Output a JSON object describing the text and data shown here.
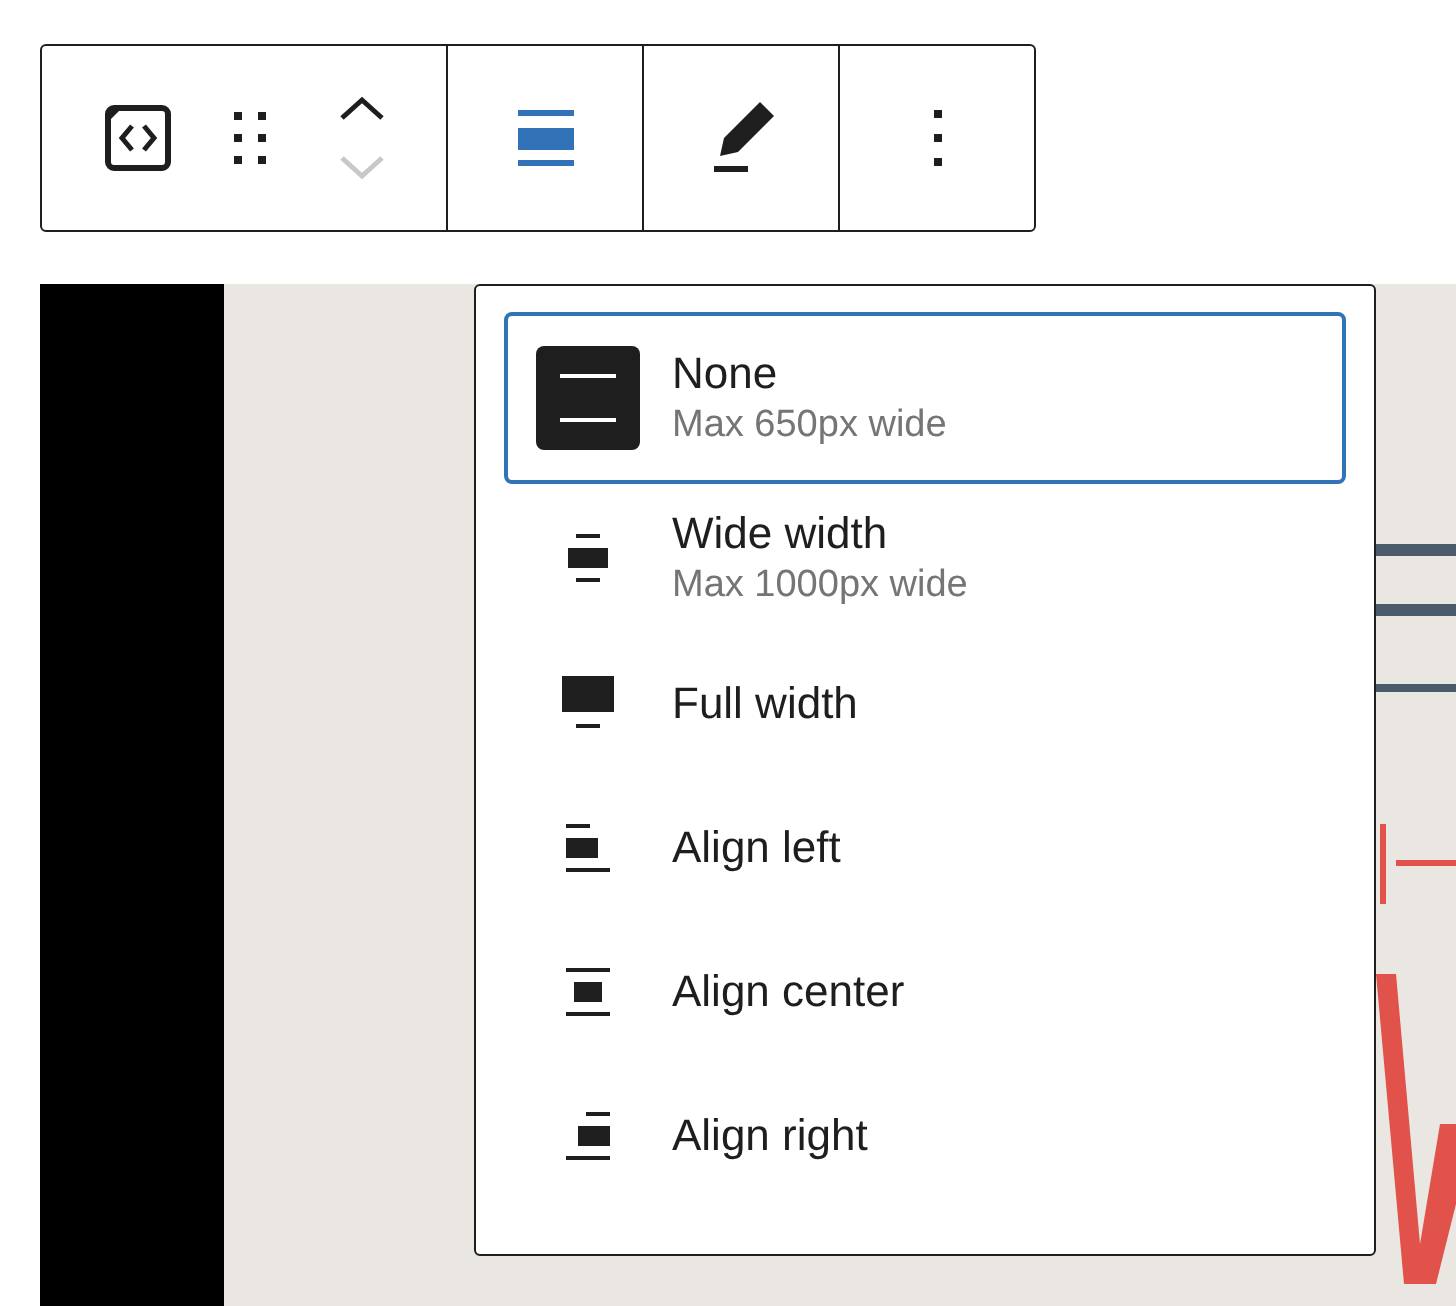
{
  "toolbar": {
    "groups": [
      {
        "buttons": [
          {
            "kind": "block_type",
            "disabled": false
          },
          {
            "kind": "drag",
            "disabled": false
          },
          {
            "kind": "mover",
            "up_disabled": false,
            "down_disabled": true
          }
        ]
      },
      {
        "buttons": [
          {
            "kind": "align",
            "expanded": true
          }
        ]
      },
      {
        "buttons": [
          {
            "kind": "edit",
            "disabled": false
          }
        ]
      },
      {
        "buttons": [
          {
            "kind": "more",
            "disabled": false
          }
        ]
      }
    ]
  },
  "align_menu": {
    "items": [
      {
        "kind": "none",
        "label": "None",
        "description": "Max 650px wide",
        "selected": true
      },
      {
        "kind": "wide",
        "label": "Wide width",
        "description": "Max 1000px wide",
        "selected": false
      },
      {
        "kind": "full",
        "label": "Full width",
        "selected": false
      },
      {
        "kind": "left",
        "label": "Align left",
        "selected": false
      },
      {
        "kind": "center",
        "label": "Align center",
        "selected": false
      },
      {
        "kind": "right",
        "label": "Align right",
        "selected": false
      }
    ]
  }
}
